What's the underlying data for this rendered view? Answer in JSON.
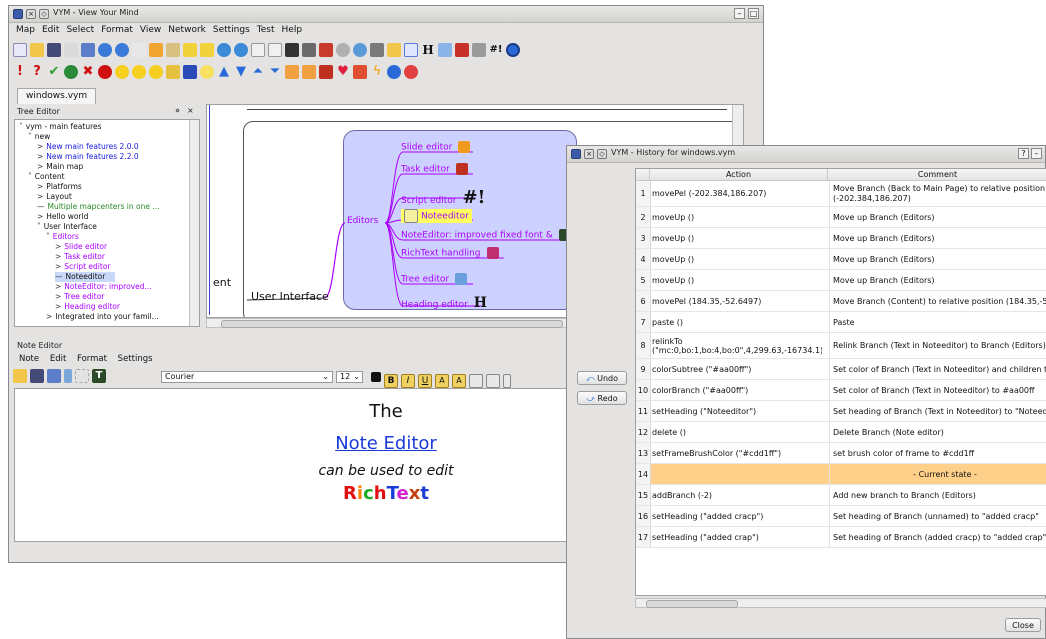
{
  "main_window": {
    "title": "VYM - View Your Mind",
    "menu": [
      "Map",
      "Edit",
      "Select",
      "Format",
      "View",
      "Network",
      "Settings",
      "Test",
      "Help"
    ],
    "tab": "windows.vym",
    "tree_editor": {
      "title": "Tree Editor",
      "rows": [
        {
          "text": "vym - main features",
          "indent": 0,
          "color": "#111111",
          "expander": "˅"
        },
        {
          "text": "new",
          "indent": 1,
          "color": "#111111",
          "expander": "˅"
        },
        {
          "text": "New main features 2.0.0",
          "indent": 2,
          "color": "#1a1ae0",
          "expander": ">"
        },
        {
          "text": "New main features 2.2.0",
          "indent": 2,
          "color": "#1a1ae0",
          "expander": ">"
        },
        {
          "text": "Main map",
          "indent": 2,
          "color": "#111111",
          "expander": ">"
        },
        {
          "text": "Content",
          "indent": 1,
          "color": "#111111",
          "expander": "˅"
        },
        {
          "text": "Platforms",
          "indent": 2,
          "color": "#111111",
          "expander": ">"
        },
        {
          "text": "Layout",
          "indent": 2,
          "color": "#111111",
          "expander": ">"
        },
        {
          "text": "Multiple mapcenters in one ...",
          "indent": 2,
          "color": "#2a8a2a",
          "expander": ""
        },
        {
          "text": "Hello world",
          "indent": 2,
          "color": "#111111",
          "expander": ">"
        },
        {
          "text": "User Interface",
          "indent": 2,
          "color": "#111111",
          "expander": "˅"
        },
        {
          "text": "Editors",
          "indent": 3,
          "color": "#aa00ff",
          "expander": "˅"
        },
        {
          "text": "Slide editor",
          "indent": 4,
          "color": "#aa00ff",
          "expander": ">"
        },
        {
          "text": "Task editor",
          "indent": 4,
          "color": "#aa00ff",
          "expander": ">"
        },
        {
          "text": "Script editor",
          "indent": 4,
          "color": "#aa00ff",
          "expander": ">"
        },
        {
          "text": "Noteeditor",
          "indent": 4,
          "color": "#111111",
          "expander": "",
          "selected": true
        },
        {
          "text": "NoteEditor: improved...",
          "indent": 4,
          "color": "#aa00ff",
          "expander": ">"
        },
        {
          "text": "Tree editor",
          "indent": 4,
          "color": "#aa00ff",
          "expander": ">"
        },
        {
          "text": "Heading editor",
          "indent": 4,
          "color": "#aa00ff",
          "expander": ">"
        },
        {
          "text": "Integrated into your famil...",
          "indent": 3,
          "color": "#111111",
          "expander": ">"
        }
      ]
    },
    "map": {
      "editors_label": "Editors",
      "user_interface_label": "User Interface",
      "ent_fragment": "ent",
      "nodes": [
        {
          "text": "Slide editor",
          "icon": "slides-icon"
        },
        {
          "text": "Task editor",
          "icon": "task-icon"
        },
        {
          "text": "Script editor",
          "icon": "script-icon",
          "icon_text": "#!"
        },
        {
          "text": "Noteeditor",
          "icon": "note-icon",
          "highlight": true
        },
        {
          "text": "NoteEditor: improved fixed font &",
          "icon": "font-icon"
        },
        {
          "text": "RichText  handling",
          "icon": "richtext-icon"
        },
        {
          "text": "Tree editor",
          "icon": "tree-icon"
        },
        {
          "text": "Heading editor",
          "icon": "heading-icon",
          "icon_text": "H"
        }
      ]
    },
    "note_editor": {
      "title": "Note Editor",
      "menu": [
        "Note",
        "Edit",
        "Format",
        "Settings"
      ],
      "font": "Courier",
      "size": "12",
      "lines": [
        "The",
        "Note Editor",
        "can be used to edit"
      ],
      "rich_letters": [
        {
          "ch": "R",
          "color": "#e01010"
        },
        {
          "ch": "i",
          "color": "#ff7f00"
        },
        {
          "ch": "c",
          "color": "#22aa22"
        },
        {
          "ch": "h",
          "color": "#e01010"
        },
        {
          "ch": "T",
          "color": "#1a3bd8"
        },
        {
          "ch": "e",
          "color": "#d020d0"
        },
        {
          "ch": "x",
          "color": "#c04010"
        },
        {
          "ch": "t",
          "color": "#1a3bd8"
        }
      ]
    }
  },
  "history_window": {
    "title": "VYM - History for windows.vym",
    "undo_label": "Undo",
    "redo_label": "Redo",
    "close_label": "Close",
    "columns": [
      "Action",
      "Comment"
    ],
    "rows": [
      {
        "n": "1",
        "action": "movePel (-202.384,186.207)",
        "comment": "Move Branch (Back to Main Page) to relative position (-202.384,186.207)"
      },
      {
        "n": "2",
        "action": "moveUp ()",
        "comment": "Move up Branch (Editors)"
      },
      {
        "n": "3",
        "action": "moveUp ()",
        "comment": "Move up Branch (Editors)"
      },
      {
        "n": "4",
        "action": "moveUp ()",
        "comment": "Move up Branch (Editors)"
      },
      {
        "n": "5",
        "action": "moveUp ()",
        "comment": "Move up Branch (Editors)"
      },
      {
        "n": "6",
        "action": "movePel (184.35,-52.6497)",
        "comment": "Move Branch (Content) to relative position (184.35,-52.6"
      },
      {
        "n": "7",
        "action": "paste ()",
        "comment": "Paste"
      },
      {
        "n": "8",
        "action": "relinkTo (\"mc:0,bo:1,bo:4,bo:0\",4,299.63,-16734.1)",
        "comment": "Relink Branch (Text in Noteeditor) to Branch (Editors)"
      },
      {
        "n": "9",
        "action": "colorSubtree (\"#aa00ff\")",
        "comment": "Set color of Branch (Text in Noteeditor) and children to #"
      },
      {
        "n": "10",
        "action": "colorBranch (\"#aa00ff\")",
        "comment": "Set color of Branch (Text in Noteeditor) to #aa00ff"
      },
      {
        "n": "11",
        "action": "setHeading (\"Noteeditor\")",
        "comment": "Set heading of Branch (Text in Noteeditor) to \"Noteedito"
      },
      {
        "n": "12",
        "action": "delete ()",
        "comment": "Delete Branch (Note editor)"
      },
      {
        "n": "13",
        "action": "setFrameBrushColor (\"#cdd1ff\")",
        "comment": "set brush color of frame to #cdd1ff"
      },
      {
        "n": "14",
        "action": "",
        "comment": "- Current state -",
        "current": true
      },
      {
        "n": "15",
        "action": "addBranch (-2)",
        "comment": "Add new branch to Branch (Editors)"
      },
      {
        "n": "16",
        "action": "setHeading (\"added cracp\")",
        "comment": "Set heading of Branch (unnamed) to \"added cracp\""
      },
      {
        "n": "17",
        "action": "setHeading (\"added crap\")",
        "comment": "Set heading of Branch (added cracp) to \"added crap\""
      }
    ]
  },
  "colors": {
    "accent_purple": "#aa00ff",
    "frame_fill": "#cdd1ff",
    "current_state": "#ffd08a"
  }
}
